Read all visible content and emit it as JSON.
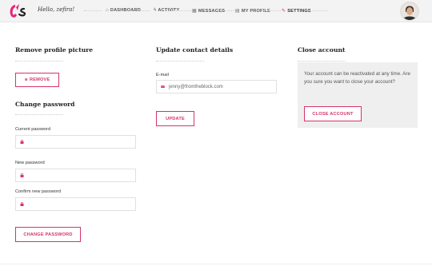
{
  "header": {
    "greeting": "Hello, zefira!",
    "nav": [
      {
        "label": "DASHBOARD",
        "icon": "home-icon"
      },
      {
        "label": "ACTIVITY",
        "icon": "activity-icon"
      },
      {
        "label": "MESSAGES",
        "icon": "messages-icon"
      },
      {
        "label": "MY PROFILE",
        "icon": "profile-icon"
      },
      {
        "label": "SETTINGS",
        "icon": "wrench-icon"
      }
    ]
  },
  "remove_picture": {
    "title": "Remove profile picture",
    "button": "REMOVE"
  },
  "change_password": {
    "title": "Change password",
    "current_label": "Current password",
    "new_label": "New password",
    "confirm_label": "Confirm new password",
    "button": "CHANGE PASSWORD"
  },
  "contact": {
    "title": "Update contact details",
    "email_label": "E-mail",
    "email_value": "jenny@fromtheblock.com",
    "button": "UPDATE"
  },
  "close_account": {
    "title": "Close account",
    "text": "Your account can be reactivated at any time. Are you sure you want to close your account?",
    "button": "CLOSE ACCOUNT"
  },
  "colors": {
    "accent": "#d6336c",
    "topbar": "#f3f3f3",
    "panel": "#efefef"
  }
}
